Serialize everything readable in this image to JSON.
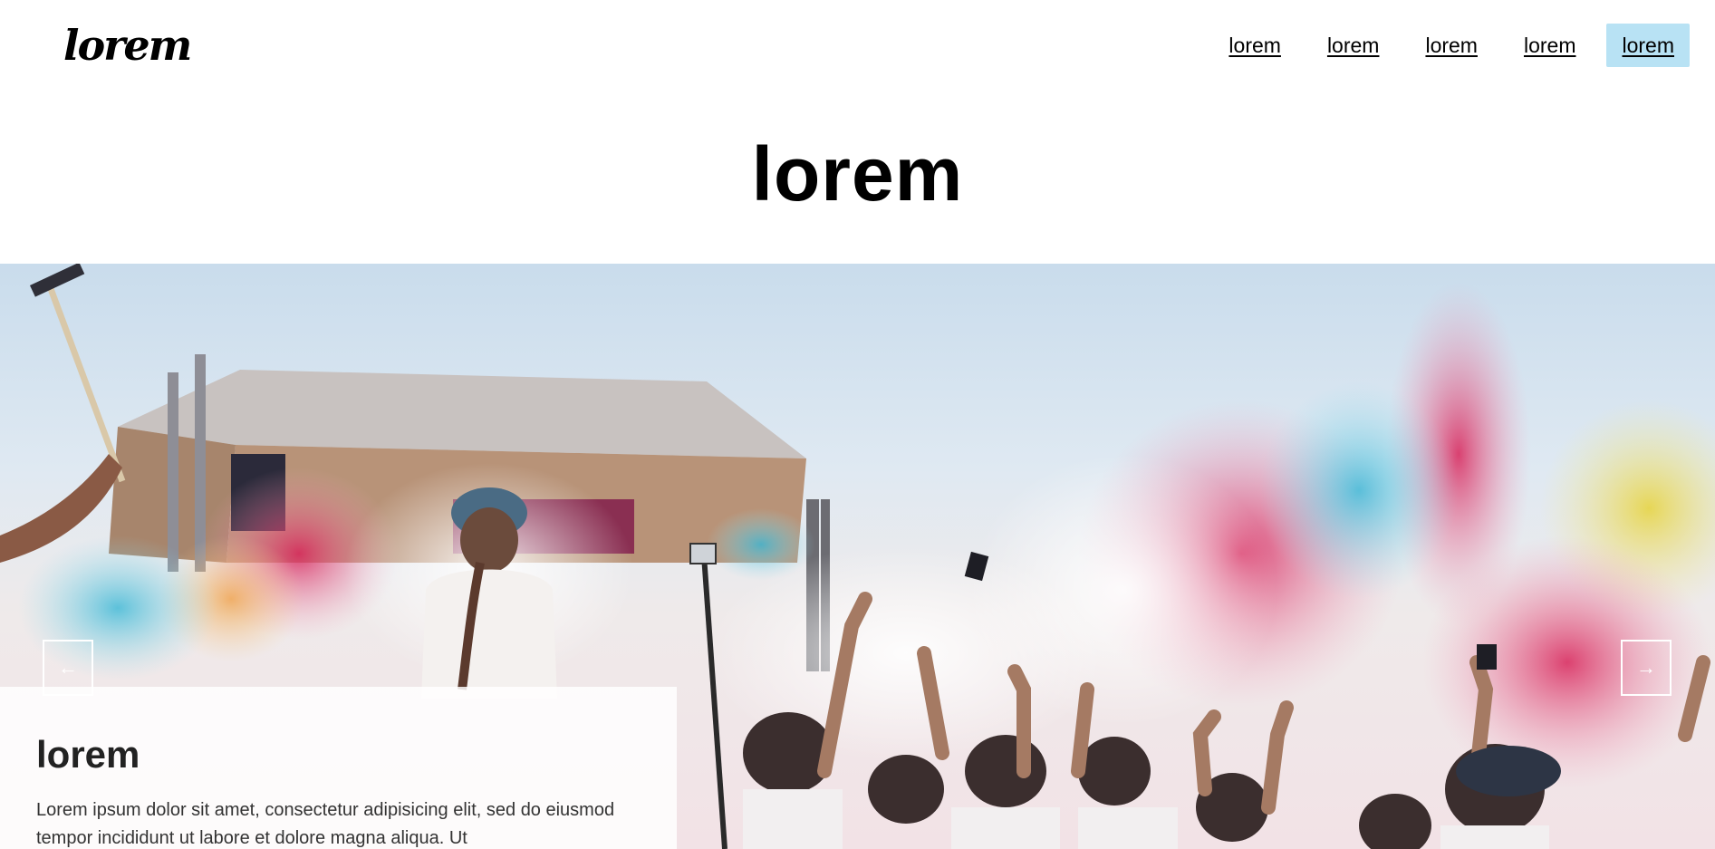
{
  "header": {
    "logo": "lorem",
    "nav": [
      {
        "label": "lorem"
      },
      {
        "label": "lorem"
      },
      {
        "label": "lorem"
      },
      {
        "label": "lorem"
      },
      {
        "label": "lorem",
        "active": true
      }
    ]
  },
  "main": {
    "title": "lorem"
  },
  "carousel": {
    "prev_icon": "arrow-left-icon",
    "next_icon": "arrow-right-icon",
    "slide": {
      "title": "lorem",
      "text": "Lorem ipsum dolor sit amet, consectetur adipisicing elit, sed do eiusmod tempor incididunt ut labore et dolore magna aliqua. Ut"
    }
  },
  "colors": {
    "nav_active_bg": "#b8e2f4",
    "sky": "#c9dcec"
  }
}
